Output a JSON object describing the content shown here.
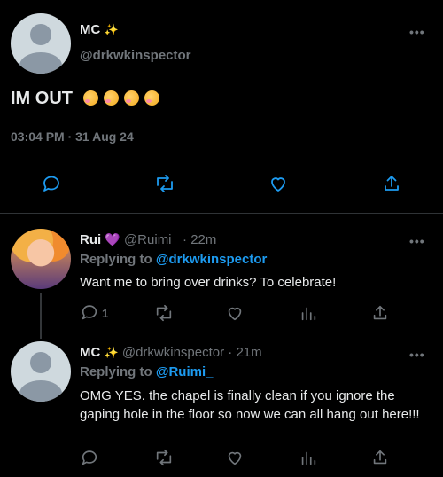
{
  "main_tweet": {
    "display_name": "MC",
    "name_emoji": "✨",
    "handle": "@drkwkinspector",
    "text": "IM OUT",
    "emojis": [
      "🥳",
      "🥳",
      "🥳",
      "🥳"
    ],
    "timestamp": "03:04 PM · 31 Aug 24",
    "more": "•••"
  },
  "replies": [
    {
      "display_name": "Rui",
      "name_emoji": "💜",
      "handle": "@Ruimi_",
      "time": "· 22m",
      "replying_label": "Replying to",
      "replying_to": "@drkwkinspector",
      "text": "Want me to bring over drinks? To celebrate!",
      "reply_count": "1",
      "more": "•••"
    },
    {
      "display_name": "MC",
      "name_emoji": "✨",
      "handle": "@drkwkinspector",
      "time": "· 21m",
      "replying_label": "Replying to",
      "replying_to": "@Ruimi_",
      "text": "OMG YES. the chapel is finally clean if you ignore the gaping hole in the floor so now we can all hang out here!!!",
      "reply_count": "",
      "more": "•••"
    }
  ],
  "icons": {
    "reply": "reply-icon",
    "retweet": "retweet-icon",
    "like": "heart-icon",
    "share": "share-icon",
    "views": "views-icon"
  }
}
